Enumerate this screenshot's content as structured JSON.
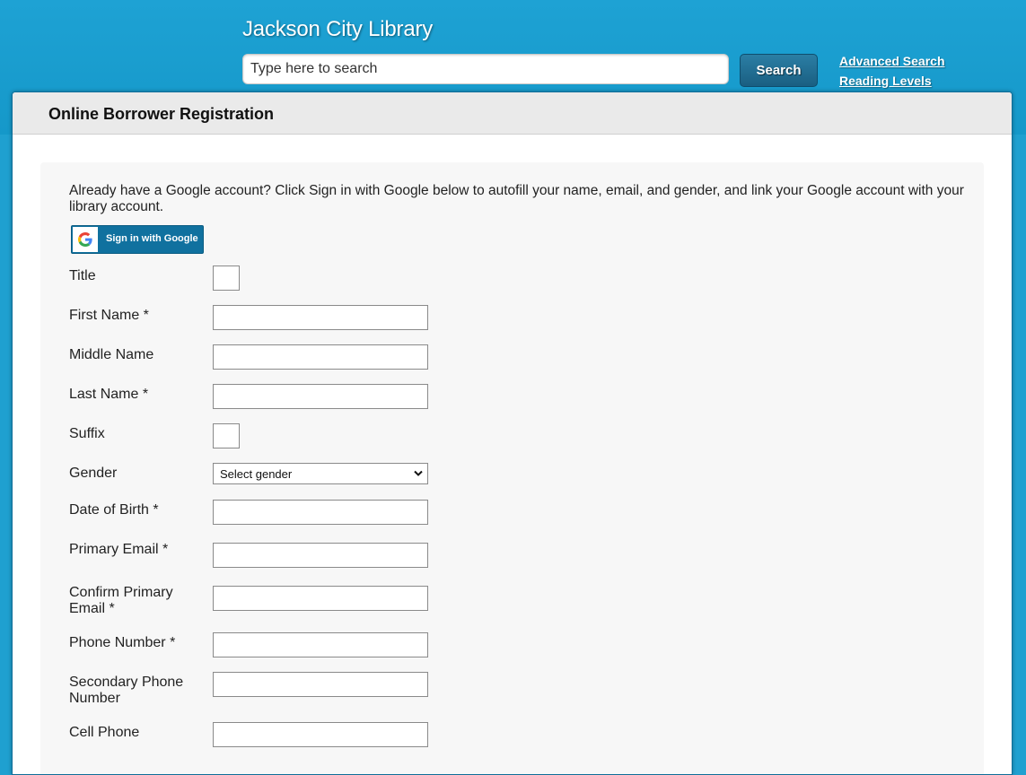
{
  "header": {
    "title": "Jackson City Library",
    "search_placeholder": "Type here to search",
    "search_button": "Search",
    "links": {
      "advanced_search": "Advanced Search",
      "reading_levels": "Reading Levels"
    }
  },
  "page": {
    "title": "Online Borrower Registration",
    "intro": "Already have a Google account? Click Sign in with Google below to autofill your name, email, and gender, and link your Google account with your library account.",
    "google_button": "Sign in with Google",
    "icon": "google-g-icon"
  },
  "form": {
    "title_label": "Title",
    "first_name_label": "First Name *",
    "middle_name_label": "Middle Name",
    "last_name_label": "Last Name *",
    "suffix_label": "Suffix",
    "gender_label": "Gender",
    "gender_selected": "Select gender",
    "dob_label": "Date of Birth *",
    "primary_email_label": "Primary Email *",
    "confirm_email_label_1": "Confirm Primary",
    "confirm_email_label_2": "Email *",
    "phone_label": "Phone Number *",
    "secondary_phone_label_1": "Secondary Phone",
    "secondary_phone_label_2": "Number",
    "cell_phone_label": "Cell Phone"
  },
  "colors": {
    "header_bg": "#1fa0d0",
    "search_button_bg": "#1a5f82",
    "google_button_bg": "#10719f",
    "title_bar_bg": "#eaeaea",
    "form_panel_bg": "#f7f7f7"
  }
}
